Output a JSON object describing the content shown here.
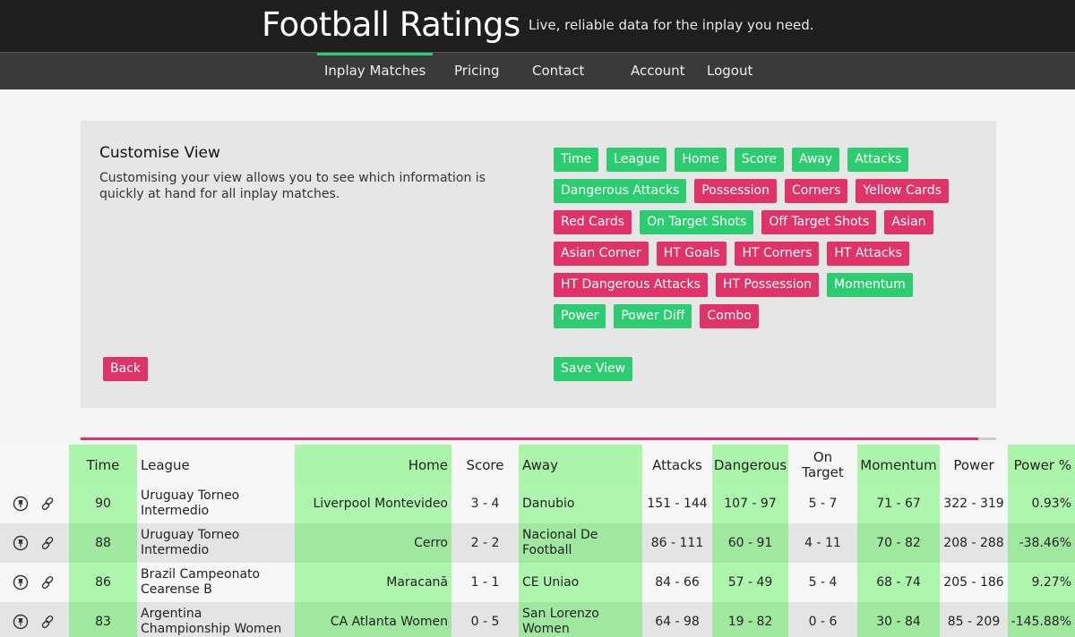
{
  "header": {
    "title": "Football Ratings",
    "tagline": "Live, reliable data for the inplay you need."
  },
  "nav": {
    "items": [
      "Inplay Matches",
      "Pricing",
      "Contact",
      "Account",
      "Logout"
    ],
    "active": "Inplay Matches"
  },
  "customise": {
    "title": "Customise View",
    "description": "Customising your view allows you to see which information is quickly at hand for all inplay matches.",
    "back_label": "Back",
    "save_label": "Save View",
    "colors": {
      "on": "#2ecc71",
      "off": "#e0336a"
    },
    "rows": [
      [
        {
          "label": "Time",
          "on": true
        },
        {
          "label": "League",
          "on": true
        },
        {
          "label": "Home",
          "on": true
        },
        {
          "label": "Score",
          "on": true
        },
        {
          "label": "Away",
          "on": true
        },
        {
          "label": "Attacks",
          "on": true
        }
      ],
      [
        {
          "label": "Dangerous Attacks",
          "on": true
        },
        {
          "label": "Possession",
          "on": false
        },
        {
          "label": "Corners",
          "on": false
        },
        {
          "label": "Yellow Cards",
          "on": false
        }
      ],
      [
        {
          "label": "Red Cards",
          "on": false
        },
        {
          "label": "On Target Shots",
          "on": true
        },
        {
          "label": "Off Target Shots",
          "on": false
        },
        {
          "label": "Asian",
          "on": false
        }
      ],
      [
        {
          "label": "Asian Corner",
          "on": false
        },
        {
          "label": "HT Goals",
          "on": false
        },
        {
          "label": "HT Corners",
          "on": false
        },
        {
          "label": "HT Attacks",
          "on": false
        }
      ],
      [
        {
          "label": "HT Dangerous Attacks",
          "on": false
        },
        {
          "label": "HT Possession",
          "on": false
        },
        {
          "label": "Momentum",
          "on": true
        }
      ],
      [
        {
          "label": "Power",
          "on": true
        },
        {
          "label": "Power Diff",
          "on": true
        },
        {
          "label": "Combo",
          "on": false
        }
      ]
    ]
  },
  "progress": {
    "fraction": 0.98,
    "color": "#e0336a"
  },
  "table": {
    "headers": {
      "time": "Time",
      "league": "League",
      "home": "Home",
      "score": "Score",
      "away": "Away",
      "attacks": "Attacks",
      "dangerous": "Dangerous",
      "on_target": "On Target",
      "momentum": "Momentum",
      "power": "Power",
      "power_pct": "Power %"
    },
    "rows": [
      {
        "time": "90",
        "league": "Uruguay Torneo Intermedio",
        "home": "Liverpool Montevideo",
        "score": "3 - 4",
        "away": "Danubio",
        "attacks": "151 - 144",
        "dangerous": "107 - 97",
        "on_target": "5 - 7",
        "momentum": "71 - 67",
        "power": "322 - 319",
        "power_pct": "0.93%"
      },
      {
        "time": "88",
        "league": "Uruguay Torneo Intermedio",
        "home": "Cerro",
        "score": "2 - 2",
        "away": "Nacional De Football",
        "attacks": "86 - 111",
        "dangerous": "60 - 91",
        "on_target": "4 - 11",
        "momentum": "70 - 82",
        "power": "208 - 288",
        "power_pct": "-38.46%"
      },
      {
        "time": "86",
        "league": "Brazil Campeonato Cearense B",
        "home": "Maracanã",
        "score": "1 - 1",
        "away": "CE Uniao",
        "attacks": "84 - 66",
        "dangerous": "57 - 49",
        "on_target": "5 - 4",
        "momentum": "68 - 74",
        "power": "205 - 186",
        "power_pct": "9.27%"
      },
      {
        "time": "83",
        "league": "Argentina Championship Women",
        "home": "CA Atlanta Women",
        "score": "0 - 5",
        "away": "San Lorenzo Women",
        "attacks": "64 - 98",
        "dangerous": "19 - 82",
        "on_target": "0 - 6",
        "momentum": "30 - 84",
        "power": "85 - 209",
        "power_pct": "-145.88%"
      }
    ],
    "row_icons": [
      "pin-icon",
      "link-icon"
    ],
    "colors": {
      "header_green": "#aaf5aa",
      "green_light": "#aef6ae",
      "green_dark": "#a0e8a0",
      "plain_light": "#f7f7f7",
      "plain_dark": "#e4e4e4"
    }
  }
}
